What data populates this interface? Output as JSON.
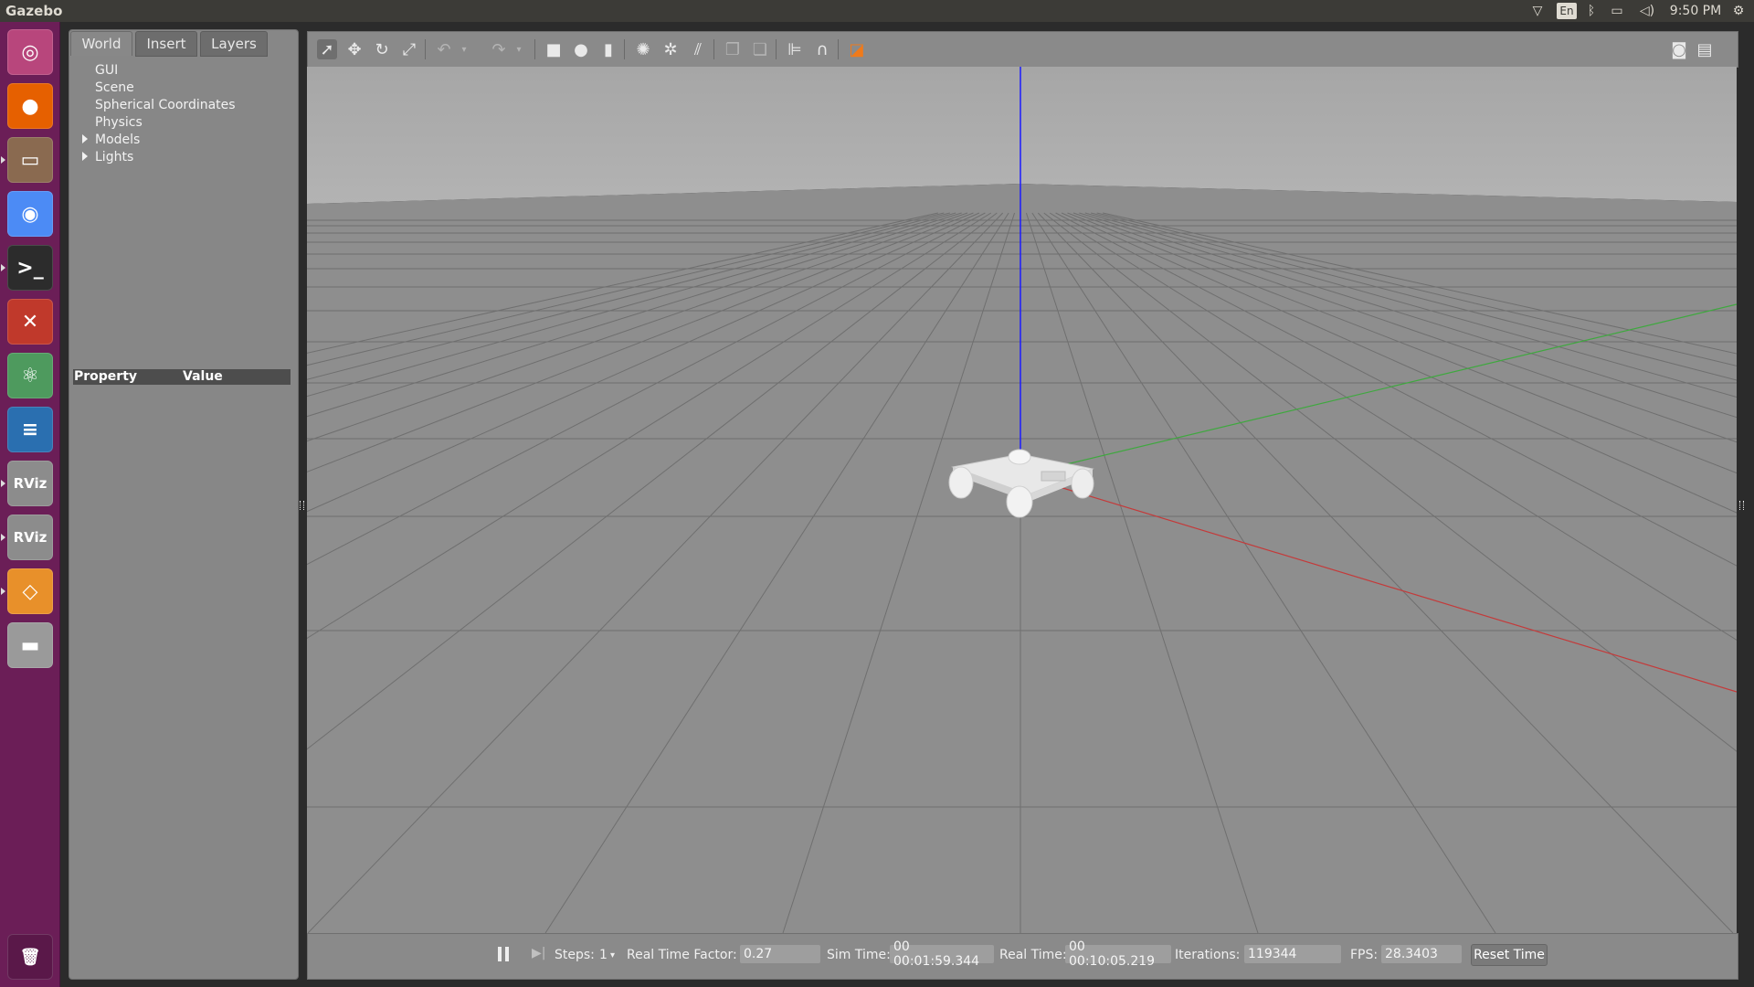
{
  "app": {
    "title": "Gazebo"
  },
  "tray": {
    "keyboard": "En",
    "time": "9:50 PM"
  },
  "launcher": {
    "items": [
      {
        "name": "ubuntu-dash-icon",
        "color": "#b8467c",
        "glyph": "◎"
      },
      {
        "name": "firefox-icon",
        "color": "#e66000",
        "glyph": "●"
      },
      {
        "name": "file-manager-icon",
        "color": "#8a6a50",
        "glyph": "▭"
      },
      {
        "name": "chrome-icon",
        "color": "#4c8bf5",
        "glyph": "◉"
      },
      {
        "name": "terminal-icon",
        "color": "#2c2c2c",
        "glyph": ">_"
      },
      {
        "name": "settings-icon",
        "color": "#c0392b",
        "glyph": "✕"
      },
      {
        "name": "atom-icon",
        "color": "#4e9a5e",
        "glyph": "⚛"
      },
      {
        "name": "writer-icon",
        "color": "#2a6fb0",
        "glyph": "≡"
      },
      {
        "name": "rviz-icon",
        "color": "#8c8c8c",
        "glyph": "RViz"
      },
      {
        "name": "rviz-icon",
        "color": "#8c8c8c",
        "glyph": "RViz"
      },
      {
        "name": "gazebo-icon",
        "color": "#e8902a",
        "glyph": "◇"
      },
      {
        "name": "drive-icon",
        "color": "#9a9a9a",
        "glyph": "▬"
      }
    ],
    "trash_glyph": "🗑"
  },
  "left_panel": {
    "tabs": [
      "World",
      "Insert",
      "Layers"
    ],
    "active_tab": "World",
    "tree": [
      "GUI",
      "Scene",
      "Spherical Coordinates",
      "Physics",
      "Models",
      "Lights"
    ],
    "property_header": "Property",
    "value_header": "Value"
  },
  "bottom_bar": {
    "steps_label": "Steps:",
    "steps_value": "1",
    "rtf_label": "Real Time Factor:",
    "rtf_value": "0.27",
    "sim_time_label": "Sim Time:",
    "sim_time_value": "00 00:01:59.344",
    "real_time_label": "Real Time:",
    "real_time_value": "00 00:10:05.219",
    "iterations_label": "Iterations:",
    "iterations_value": "119344",
    "fps_label": "FPS:",
    "fps_value": "28.3403",
    "reset_label": "Reset Time"
  }
}
